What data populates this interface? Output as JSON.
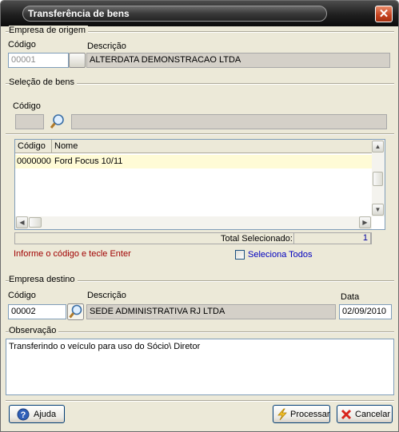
{
  "window": {
    "title": "Transferência de  bens",
    "close_glyph": "✕"
  },
  "origem": {
    "group_label": "Empresa de origem",
    "codigo_label": "Código",
    "descricao_label": "Descrição",
    "codigo_value": "00001",
    "descricao_value": "ALTERDATA DEMONSTRACAO LTDA"
  },
  "selecao": {
    "group_label": "Seleção de bens",
    "codigo_label": "Código",
    "codigo_value": "",
    "descricao_value": "",
    "columns": [
      "Código",
      "Nome"
    ],
    "rows": [
      {
        "codigo": "0000000",
        "nome": "Ford Focus 10/11"
      }
    ],
    "total_label": "Total Selecionado:",
    "total_value": "1",
    "hint": "Informe o código e tecle Enter",
    "seleciona_todos": "Seleciona Todos"
  },
  "destino": {
    "group_label": "Empresa destino",
    "codigo_label": "Código",
    "descricao_label": "Descrição",
    "data_label": "Data",
    "codigo_value": "00002",
    "descricao_value": "SEDE ADMINISTRATIVA RJ LTDA",
    "data_value": "02/09/2010"
  },
  "observacao": {
    "group_label": "Observação",
    "text": "Transferindo o veículo para uso do Sócio\\ Diretor"
  },
  "buttons": {
    "ajuda": "Ajuda",
    "processar": "Processar",
    "cancelar": "Cancelar"
  },
  "colors": {
    "hint_red": "#a00000",
    "link_blue": "#0000c0",
    "row_highlight": "#fffbd6"
  }
}
